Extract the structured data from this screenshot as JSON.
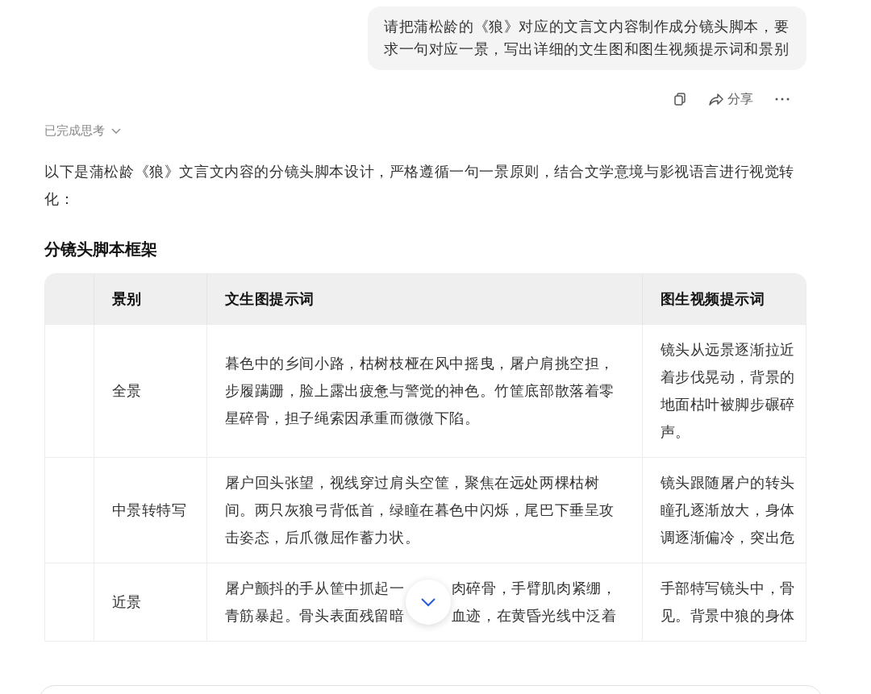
{
  "user_message": {
    "text": "请把蒲松龄的《狼》对应的文言文内容制作成分镜头脚本，要求一句对应一景，写出详细的文生图和图生视频提示词和景别"
  },
  "message_actions": {
    "share": "分享"
  },
  "thinking": {
    "label": "已完成思考",
    "expanded": false
  },
  "answer": {
    "intro": "以下是蒲松龄《狼》文言文内容的分镜头脚本设计，严格遵循一句一景原则，结合文学意境与影视语言进行视觉转化：",
    "heading": "分镜头脚本框架"
  },
  "table": {
    "columns": [
      "景别",
      "文生图提示词",
      "图生视频提示词"
    ],
    "rows": [
      {
        "shot": "全景",
        "image_prompt": "暮色中的乡间小路，枯树枝桠在风中摇曳，屠户肩挑空担，步履蹒跚，脸上露出疲惫与警觉的神色。竹筐底部散落着零星碎骨，担子绳索因承重而微微下陷。",
        "video_prompt_lines": [
          "镜头从远景逐渐拉近",
          "着步伐晃动，背景的",
          "地面枯叶被脚步碾碎",
          "声。"
        ]
      },
      {
        "shot": "中景转特写",
        "image_prompt": "屠户回头张望，视线穿过肩头空筐，聚焦在远处两棵枯树间。两只灰狼弓背低首，绿瞳在暮色中闪烁，尾巴下垂呈攻击姿态，后爪微屈作蓄力状。",
        "video_prompt_lines": [
          "镜头跟随屠户的转头",
          "瞳孔逐渐放大，身体",
          "调逐渐偏冷，突出危"
        ]
      },
      {
        "shot": "近景",
        "image_prompt_segments": [
          [
            "屠户颤抖的手从筐中抓起一",
            "肉碎骨，手臂肌肉紧绷，"
          ],
          [
            "青筋暴起。骨头表面残留暗",
            "血迹，在黄昏光线中泛着"
          ]
        ],
        "video_prompt_lines": [
          "手部特写镜头中，骨",
          "见。背景中狼的身体"
        ]
      }
    ]
  }
}
